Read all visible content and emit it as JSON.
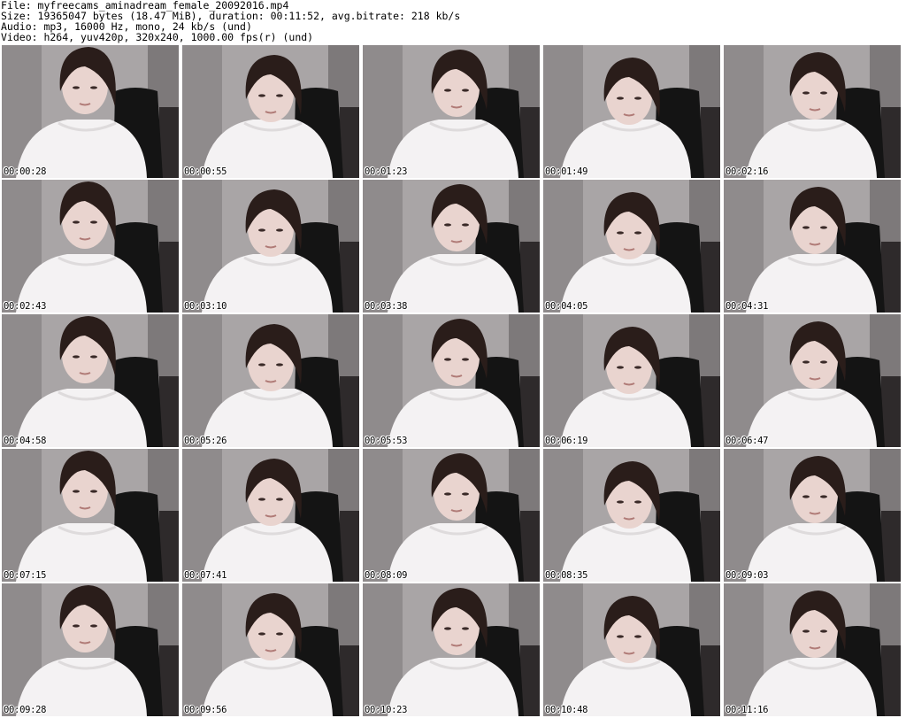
{
  "info": {
    "file": "File: myfreecams_aminadream_female_20092016.mp4",
    "size": "Size: 19365047 bytes (18.47 MiB), duration: 00:11:52, avg.bitrate: 218 kb/s",
    "audio": "Audio: mp3, 16000 Hz, mono, 24 kb/s (und)",
    "video": "Video: h264, yuv420p, 320x240, 1000.00 fps(r) (und)"
  },
  "thumbnails": [
    {
      "timestamp": "00:00:28"
    },
    {
      "timestamp": "00:00:55"
    },
    {
      "timestamp": "00:01:23"
    },
    {
      "timestamp": "00:01:49"
    },
    {
      "timestamp": "00:02:16"
    },
    {
      "timestamp": "00:02:43"
    },
    {
      "timestamp": "00:03:10"
    },
    {
      "timestamp": "00:03:38"
    },
    {
      "timestamp": "00:04:05"
    },
    {
      "timestamp": "00:04:31"
    },
    {
      "timestamp": "00:04:58"
    },
    {
      "timestamp": "00:05:26"
    },
    {
      "timestamp": "00:05:53"
    },
    {
      "timestamp": "00:06:19"
    },
    {
      "timestamp": "00:06:47"
    },
    {
      "timestamp": "00:07:15"
    },
    {
      "timestamp": "00:07:41"
    },
    {
      "timestamp": "00:08:09"
    },
    {
      "timestamp": "00:08:35"
    },
    {
      "timestamp": "00:09:03"
    },
    {
      "timestamp": "00:09:28"
    },
    {
      "timestamp": "00:09:56"
    },
    {
      "timestamp": "00:10:23"
    },
    {
      "timestamp": "00:10:48"
    },
    {
      "timestamp": "00:11:16"
    }
  ]
}
